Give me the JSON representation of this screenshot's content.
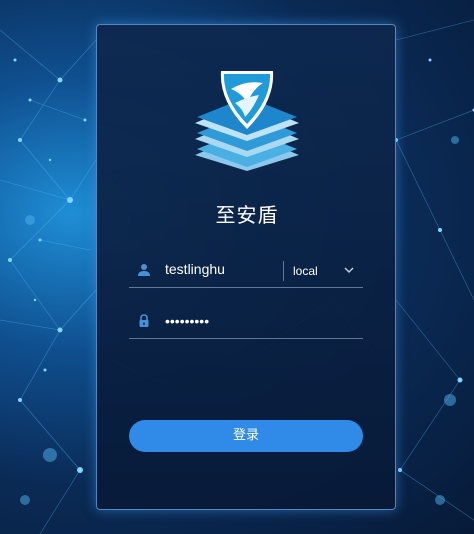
{
  "app": {
    "title": "至安盾"
  },
  "login_form": {
    "username": "testlinghu",
    "realm": "local",
    "password_masked": "•••••••••",
    "submit_label": "登录"
  },
  "colors": {
    "button": "#2f8ae8",
    "card_border": "#6eaae6",
    "logo_blue": "#1e9bd8"
  },
  "icons": [
    "user-icon",
    "lock-icon",
    "chevron-down-icon",
    "shield-logo"
  ]
}
